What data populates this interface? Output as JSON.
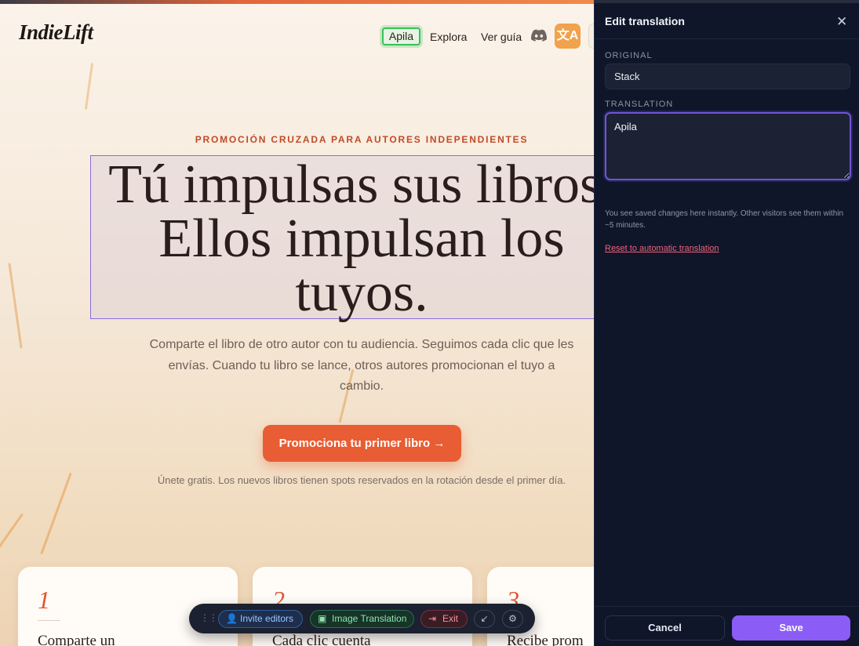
{
  "site": {
    "logo": "IndieLift",
    "nav": {
      "active": "Apila",
      "explore": "Explora",
      "guide": "Ver guía",
      "discord_icon": "discord-icon",
      "translate_icon": "translate-icon"
    },
    "hero": {
      "eyebrow": "PROMOCIÓN CRUZADA PARA AUTORES INDEPENDIENTES",
      "line1": "Tú impulsas sus libros.",
      "line2": "Ellos impulsan los",
      "line3": "tuyos.",
      "subtitle": "Comparte el libro de otro autor con tu audiencia. Seguimos cada clic que les envías. Cuando tu libro se lance, otros autores promocionan el tuyo a cambio.",
      "cta": "Promociona tu primer libro →",
      "fineprint": "Únete gratis. Los nuevos libros tienen spots reservados en la rotación desde el primer día."
    },
    "cards": [
      {
        "num": "1",
        "title": "Comparte un"
      },
      {
        "num": "2",
        "title": "Cada clic cuenta"
      },
      {
        "num": "3",
        "title": "Recibe prom"
      }
    ],
    "colors": {
      "accent": "#e85d33",
      "highlight_border": "#8a6cd8",
      "active_nav": "#3bbf5b"
    }
  },
  "toolbar": {
    "invite": "Invite editors",
    "image_translation": "Image Translation",
    "exit": "Exit",
    "icons": [
      "drag-handle-icon",
      "user-plus-icon",
      "image-icon",
      "exit-icon",
      "collapse-icon",
      "gear-icon"
    ]
  },
  "panel": {
    "title": "Edit translation",
    "close_icon": "close-icon",
    "original_label": "ORIGINAL",
    "original_value": "Stack",
    "translation_label": "TRANSLATION",
    "translation_value": "Apila",
    "note": "You see saved changes here instantly. Other visitors see them within ~5 minutes.",
    "reset": "Reset to automatic translation",
    "cancel": "Cancel",
    "save": "Save",
    "colors": {
      "background": "#0f162a",
      "save": "#8b5cf6",
      "reset": "#f0627b"
    }
  }
}
